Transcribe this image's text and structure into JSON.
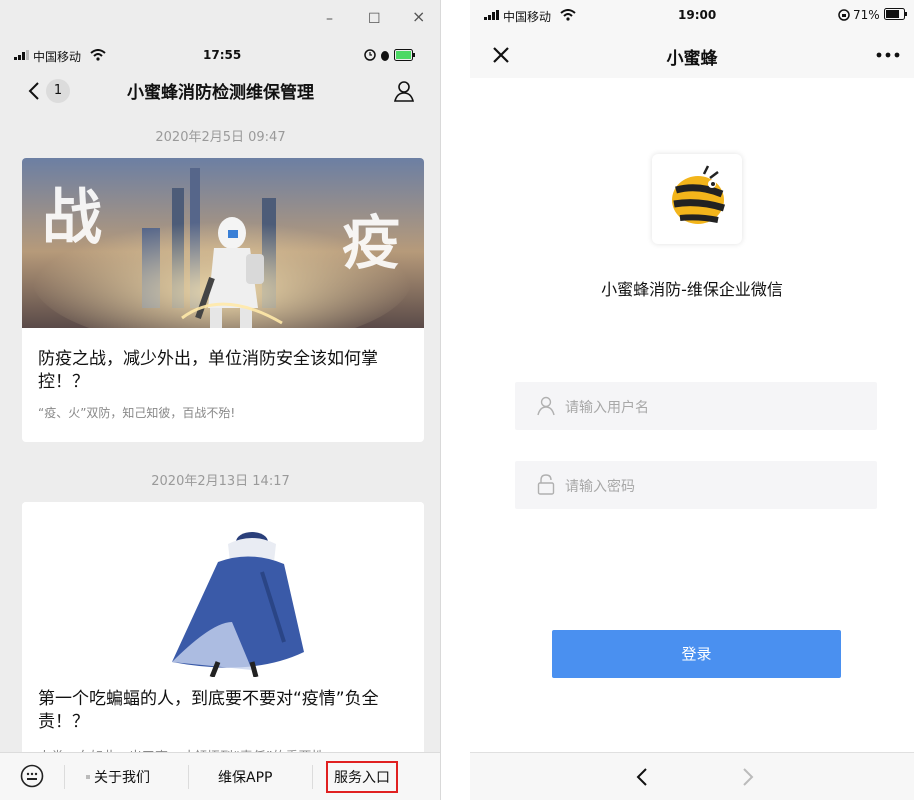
{
  "left": {
    "window_controls": {
      "minimize": "–",
      "maximize": "☐",
      "close": "×"
    },
    "status": {
      "carrier": "中国移动",
      "time": "17:55"
    },
    "nav": {
      "back_badge": "1",
      "title": "小蜜蜂消防检测维保管理"
    },
    "articles": [
      {
        "timestamp": "2020年2月5日 09:47",
        "image_chars": [
          "战",
          "疫"
        ],
        "title": "防疫之战，减少外出，单位消防安全该如何掌控！？",
        "summary": "“疫、火”双防，知己知彼，百战不殆!"
      },
      {
        "timestamp": "2020年2月13日 14:17",
        "title": "第一个吃蝙蝠的人，到底要不要对“疫情”负全责！？",
        "summary": "人类一向如此，出了事，才领悟到“责任”的重要性"
      }
    ],
    "bottom_menu": {
      "items": [
        "关于我们",
        "维保APP",
        "服务入口"
      ],
      "highlight_color": "#e02020"
    }
  },
  "right": {
    "status": {
      "carrier": "中国移动",
      "time": "19:00",
      "battery": "71%"
    },
    "nav": {
      "title": "小蜜蜂"
    },
    "app_name": "小蜜蜂消防-维保企业微信",
    "username_placeholder": "请输入用户名",
    "password_placeholder": "请输入密码",
    "login_label": "登录",
    "accent_color": "#4a90f0"
  }
}
